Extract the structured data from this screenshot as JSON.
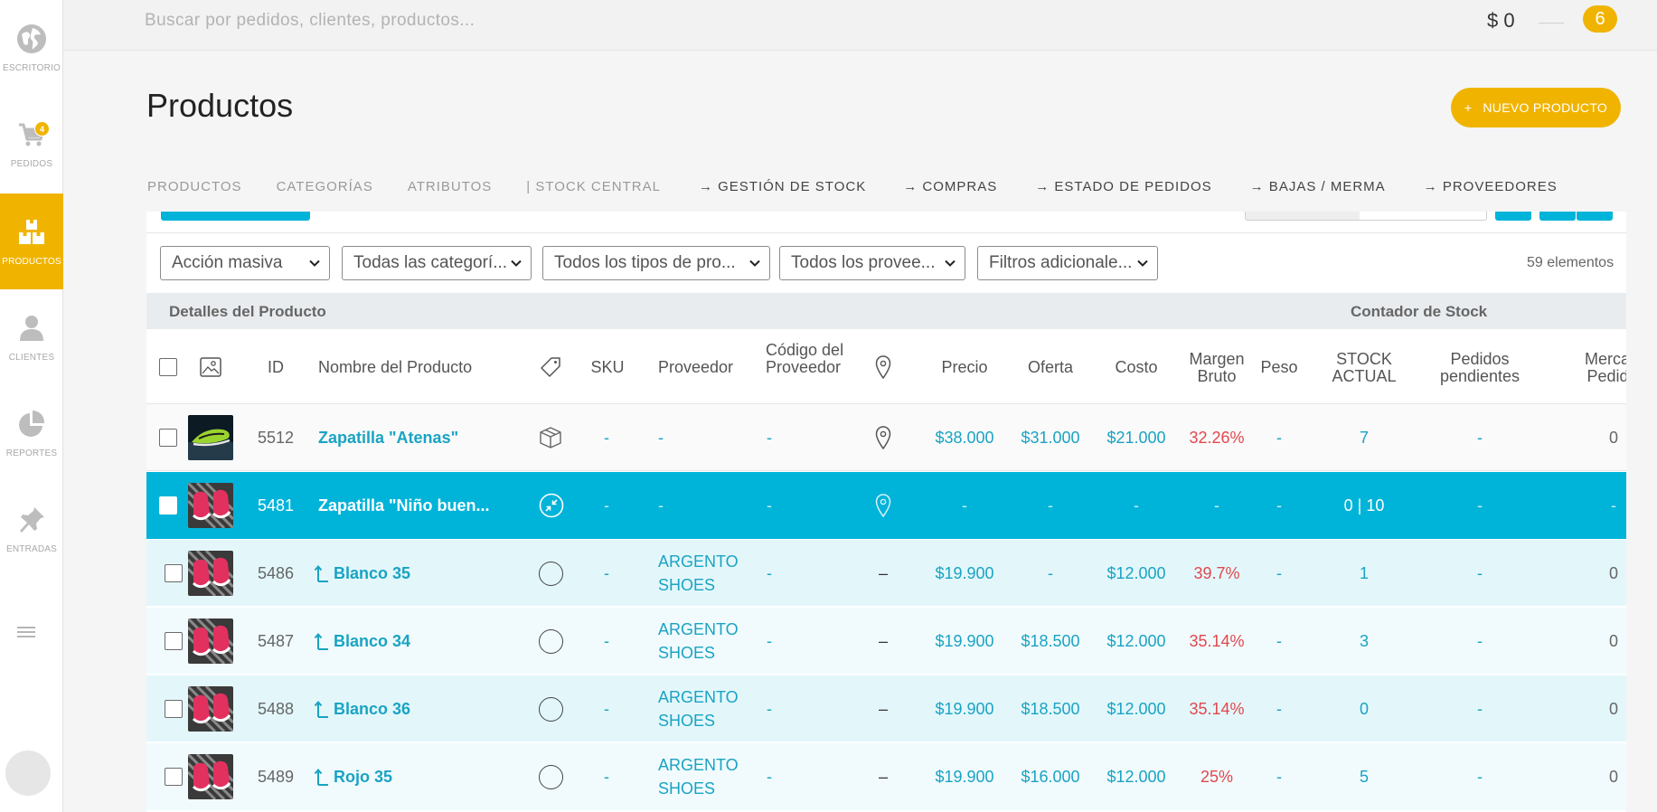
{
  "sidebar": {
    "items": [
      {
        "label": "ESCRITORIO",
        "icon": "globe-icon"
      },
      {
        "label": "PEDIDOS",
        "icon": "cart-icon",
        "badge": "4"
      },
      {
        "label": "PRODUCTOS",
        "icon": "boxes-icon",
        "active": true
      },
      {
        "label": "CLIENTES",
        "icon": "user-icon"
      },
      {
        "label": "REPORTES",
        "icon": "pie-chart-icon"
      },
      {
        "label": "ENTRADAS",
        "icon": "pin-icon"
      }
    ]
  },
  "topbar": {
    "search_placeholder": "Buscar por pedidos, clientes, productos...",
    "balance": "$ 0",
    "notifications": "6"
  },
  "header": {
    "title": "Productos",
    "new_button": "NUEVO PRODUCTO",
    "new_button_icon": "+"
  },
  "tabs": [
    "PRODUCTOS",
    "CATEGORÍAS",
    "ATRIBUTOS",
    "| STOCK CENTRAL",
    "→ GESTIÓN DE STOCK",
    "→ COMPRAS",
    "→ ESTADO DE PEDIDOS",
    "→ BAJAS / MERMA",
    "→ PROVEEDORES"
  ],
  "filters": [
    "Acción masiva",
    "Todas las categorí...",
    "Todos los tipos de pro...",
    "Todos los provee...",
    "Filtros adicionale..."
  ],
  "items_count": "59 elementos",
  "table": {
    "groups": {
      "details": "Detalles del Producto",
      "stock": "Contador de Stock"
    },
    "columns": {
      "id": "ID",
      "name": "Nombre del Producto",
      "sku": "SKU",
      "supplier": "Proveedor",
      "supplier_code": "Código del Proveedor",
      "price": "Precio",
      "offer": "Oferta",
      "cost": "Costo",
      "margin": "Margen Bruto",
      "weight": "Peso",
      "stock": "STOCK ACTUAL",
      "pending": "Pedidos pendientes",
      "market": "Mercado Pedidos"
    },
    "rows": [
      {
        "id": "5512",
        "name": "Zapatilla \"Atenas\"",
        "variation": false,
        "type_icon": "box-icon",
        "sku": "-",
        "supplier": "-",
        "supplier_code": "-",
        "location": "pin",
        "price": "$38.000",
        "offer": "$31.000",
        "cost": "$21.000",
        "margin": "32.26%",
        "weight": "-",
        "stock": "7",
        "pending": "-",
        "market": "0",
        "thumb": "green"
      },
      {
        "id": "5481",
        "name": "Zapatilla \"Niño buen...",
        "variation": false,
        "type_icon": "collapse-icon",
        "sku": "-",
        "supplier": "-",
        "supplier_code": "-",
        "location": "pin",
        "price": "-",
        "offer": "-",
        "cost": "-",
        "margin": "-",
        "weight": "-",
        "stock": "0 | 10",
        "pending": "-",
        "market": "-",
        "thumb": "pink",
        "selected": true
      },
      {
        "id": "5486",
        "name": "Blanco 35",
        "variation": true,
        "type_icon": "circle",
        "sku": "-",
        "supplier": "ARGENTO SHOES",
        "supplier_code": "-",
        "location": "–",
        "price": "$19.900",
        "offer": "-",
        "cost": "$12.000",
        "margin": "39.7%",
        "weight": "-",
        "stock": "1",
        "pending": "-",
        "market": "0",
        "thumb": "pink"
      },
      {
        "id": "5487",
        "name": "Blanco 34",
        "variation": true,
        "type_icon": "circle",
        "sku": "-",
        "supplier": "ARGENTO SHOES",
        "supplier_code": "-",
        "location": "–",
        "price": "$19.900",
        "offer": "$18.500",
        "cost": "$12.000",
        "margin": "35.14%",
        "weight": "-",
        "stock": "3",
        "pending": "-",
        "market": "0",
        "thumb": "pink"
      },
      {
        "id": "5488",
        "name": "Blanco 36",
        "variation": true,
        "type_icon": "circle",
        "sku": "-",
        "supplier": "ARGENTO SHOES",
        "supplier_code": "-",
        "location": "–",
        "price": "$19.900",
        "offer": "$18.500",
        "cost": "$12.000",
        "margin": "35.14%",
        "weight": "-",
        "stock": "0",
        "pending": "-",
        "market": "0",
        "thumb": "pink"
      },
      {
        "id": "5489",
        "name": "Rojo 35",
        "variation": true,
        "type_icon": "circle",
        "sku": "-",
        "supplier": "ARGENTO SHOES",
        "supplier_code": "-",
        "location": "–",
        "price": "$19.900",
        "offer": "$16.000",
        "cost": "$12.000",
        "margin": "25%",
        "weight": "-",
        "stock": "5",
        "pending": "-",
        "market": "0",
        "thumb": "pink"
      }
    ]
  },
  "colors": {
    "accent": "#f0b400",
    "teal": "#00b3d9",
    "link": "#1aa3c3",
    "margin_red": "#e0484e"
  }
}
